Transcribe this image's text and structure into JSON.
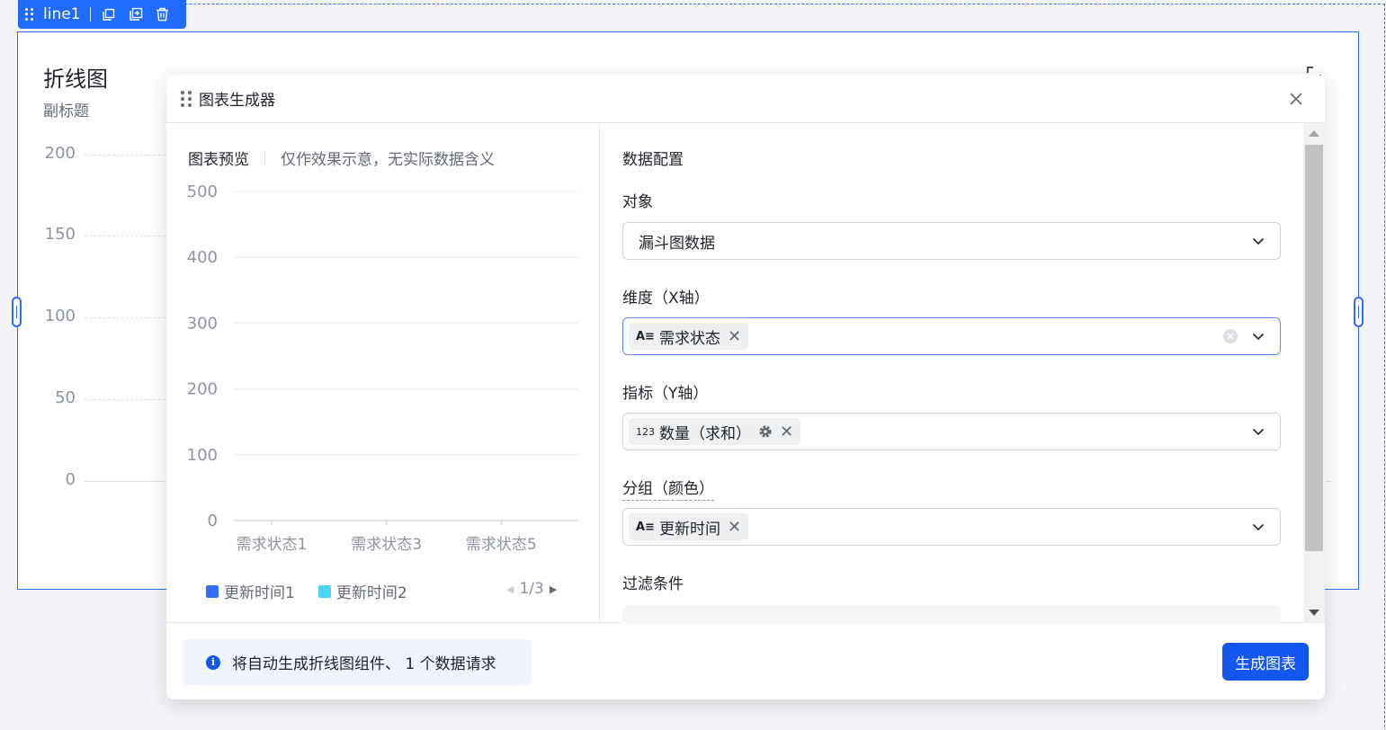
{
  "component_toolbar": {
    "name": "line1"
  },
  "component": {
    "title": "折线图",
    "subtitle": "副标题",
    "y_ticks": [
      "200",
      "150",
      "100",
      "50",
      "0"
    ]
  },
  "modal": {
    "title": "图表生成器",
    "preview": {
      "title": "图表预览",
      "note": "仅作效果示意，无实际数据含义",
      "pager": "1/3"
    },
    "config": {
      "section_title": "数据配置",
      "object_label": "对象",
      "object_value": "漏斗图数据",
      "dimension_label": "维度（X轴）",
      "dimension_tag": "需求状态",
      "dimension_type_icon": "A≡",
      "metric_label": "指标（Y轴）",
      "metric_tag": "数量（求和）",
      "metric_type_icon": "123",
      "group_label": "分组（颜色）",
      "group_tag": "更新时间",
      "group_type_icon": "A≡",
      "filter_label": "过滤条件"
    },
    "footer": {
      "info_text": "将自动生成折线图组件、 1 个数据请求",
      "generate_button": "生成图表"
    }
  },
  "colors": {
    "primary": "#1456f0",
    "series1": "#3370ff",
    "series2": "#4cd4f5"
  },
  "chart_data": {
    "type": "line",
    "categories": [
      "需求状态1",
      "需求状态3",
      "需求状态5"
    ],
    "y_ticks": [
      500,
      400,
      300,
      200,
      100,
      0
    ],
    "ylim": [
      0,
      500
    ],
    "series": [
      {
        "name": "更新时间1",
        "color": "#3370ff",
        "values": []
      },
      {
        "name": "更新时间2",
        "color": "#4cd4f5",
        "values": []
      }
    ],
    "grid": true,
    "legend": "bottom-left"
  }
}
